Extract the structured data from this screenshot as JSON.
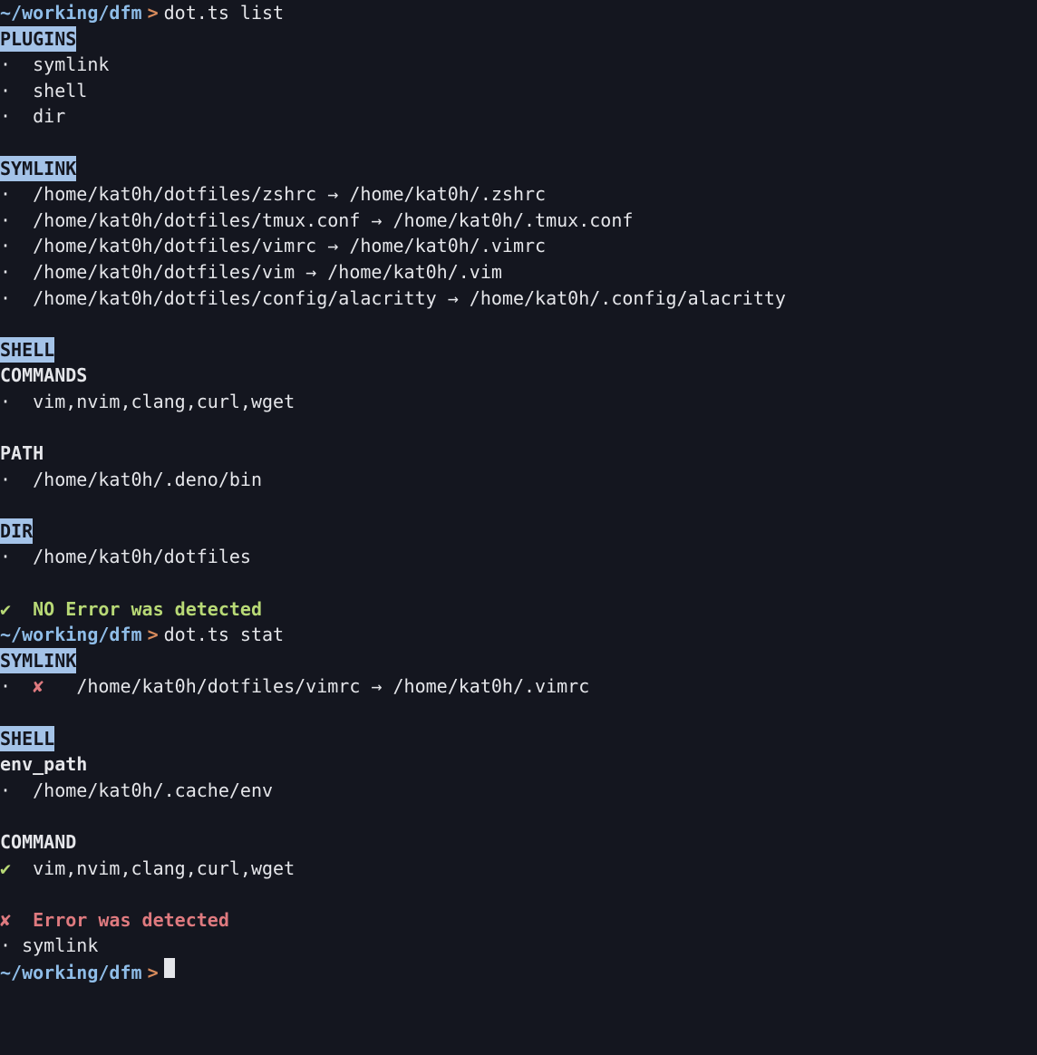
{
  "prompt": {
    "cwd": "~/working/dfm",
    "arrow": ">"
  },
  "commands": {
    "list": "dot.ts list",
    "stat": "dot.ts stat"
  },
  "list_output": {
    "plugins": {
      "header": "PLUGINS",
      "items": [
        "symlink",
        "shell",
        "dir"
      ]
    },
    "symlink": {
      "header": "SYMLINK",
      "items": [
        "/home/kat0h/dotfiles/zshrc → /home/kat0h/.zshrc",
        "/home/kat0h/dotfiles/tmux.conf → /home/kat0h/.tmux.conf",
        "/home/kat0h/dotfiles/vimrc → /home/kat0h/.vimrc",
        "/home/kat0h/dotfiles/vim → /home/kat0h/.vim",
        "/home/kat0h/dotfiles/config/alacritty → /home/kat0h/.config/alacritty"
      ]
    },
    "shell": {
      "header": "SHELL",
      "commands_label": "COMMANDS",
      "commands_value": "vim,nvim,clang,curl,wget",
      "path_label": "PATH",
      "path_value": "/home/kat0h/.deno/bin"
    },
    "dir": {
      "header": "DIR",
      "value": "/home/kat0h/dotfiles"
    },
    "result": {
      "icon": "✔",
      "message": "NO Error was detected"
    }
  },
  "stat_output": {
    "symlink": {
      "header": "SYMLINK",
      "item_icon": "✘",
      "item_text": "/home/kat0h/dotfiles/vimrc → /home/kat0h/.vimrc"
    },
    "shell": {
      "header": "SHELL",
      "env_path_label": "env_path",
      "env_path_value": "/home/kat0h/.cache/env"
    },
    "command": {
      "header": "COMMAND",
      "icon": "✔",
      "value": "vim,nvim,clang,curl,wget"
    },
    "result": {
      "icon": "✘",
      "message": "Error was detected",
      "detail": "symlink"
    }
  },
  "bullet": "·"
}
